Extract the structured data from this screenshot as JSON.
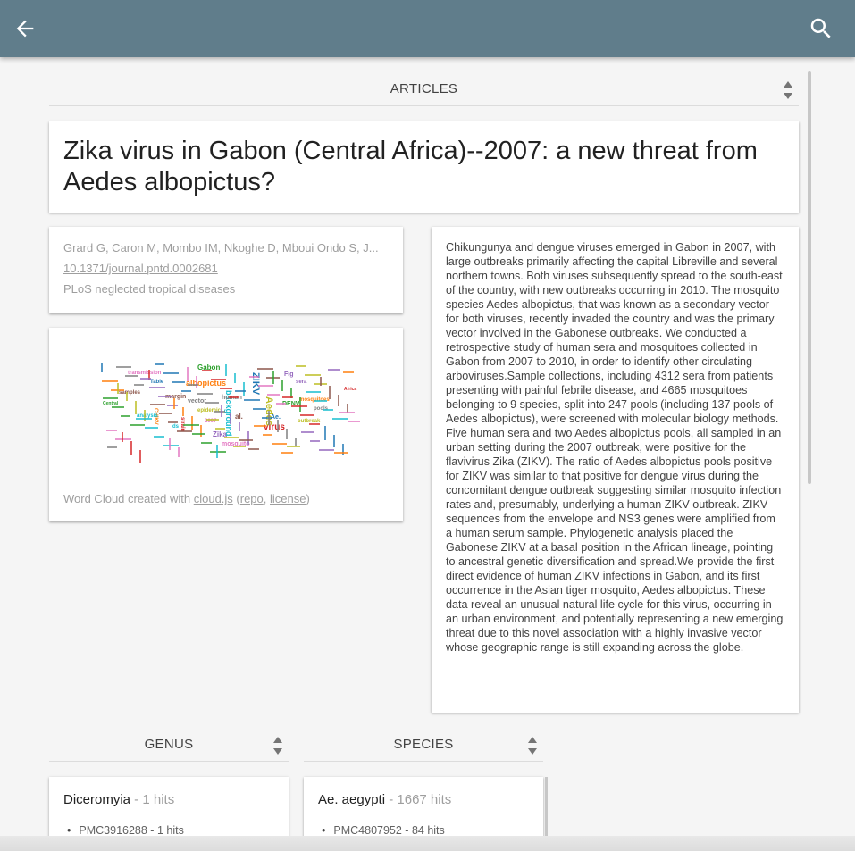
{
  "toolbar": {
    "back_icon": "arrow-back-icon",
    "search_icon": "search-icon",
    "color": "#607d8b"
  },
  "articles_header": {
    "label": "ARTICLES"
  },
  "article": {
    "title": "Zika virus in Gabon (Central Africa)--2007: a new threat from Aedes albopictus?",
    "authors": "Grard G, Caron M, Mombo IM, Nkoghe D, Mboui Ondo S, J...",
    "doi": "10.1371/journal.pntd.0002681",
    "journal": "PLoS neglected tropical diseases",
    "abstract": "Chikungunya and dengue viruses emerged in Gabon in 2007, with large outbreaks primarily affecting the capital Libreville and several northern towns. Both viruses subsequently spread to the south-east of the country, with new outbreaks occurring in 2010. The mosquito species Aedes albopictus, that was known as a secondary vector for both viruses, recently invaded the country and was the primary vector involved in the Gabonese outbreaks. We conducted a retrospective study of human sera and mosquitoes collected in Gabon from 2007 to 2010, in order to identify other circulating arboviruses.Sample collections, including 4312 sera from patients presenting with painful febrile disease, and 4665 mosquitoes belonging to 9 species, split into 247 pools (including 137 pools of Aedes albopictus), were screened with molecular biology methods. Five human sera and two Aedes albopictus pools, all sampled in an urban setting during the 2007 outbreak, were positive for the flavivirus Zika (ZIKV). The ratio of Aedes albopictus pools positive for ZIKV was similar to that positive for dengue virus during the concomitant dengue outbreak suggesting similar mosquito infection rates and, presumably, underlying a human ZIKV outbreak. ZIKV sequences from the envelope and NS3 genes were amplified from a human serum sample. Phylogenetic analysis placed the Gabonese ZIKV at a basal position in the African lineage, pointing to ancestral genetic diversification and spread.We provide the first direct evidence of human ZIKV infections in Gabon, and its first occurrence in the Asian tiger mosquito, Aedes albopictus. These data reveal an unusual natural life cycle for this virus, occurring in an urban environment, and potentially representing a new emerging threat due to this novel association with a highly invasive vector whose geographic range is still expanding across the globe."
  },
  "word_cloud": {
    "credit_prefix": "Word Cloud created with ",
    "lib_link": "cloud.js",
    "open_paren": " (",
    "repo_link": "repo",
    "comma": ", ",
    "license_link": "license",
    "close_paren": ")",
    "words": [
      "ZIKV",
      "albopictus",
      "Gabon",
      "virus",
      "Zika",
      "margin",
      "mosquito",
      "vector",
      "Aedes",
      "background",
      "Table",
      "CHIKV",
      "DENV",
      "strain",
      "sera",
      "samples",
      "transmission",
      "pools",
      "outbreak",
      "analysis",
      "Ae.",
      "mosquitoes",
      "Central",
      "Africa",
      "Fig",
      "al.",
      "2007",
      "human",
      "epidemic",
      "ds"
    ]
  },
  "genus_header": {
    "label": "GENUS"
  },
  "species_header": {
    "label": "SPECIES"
  },
  "genus_result": {
    "name": "Diceromyia",
    "hits": " - 1 hits",
    "items": [
      "PMC3916288 - 1 hits"
    ]
  },
  "species_result": {
    "name": "Ae. aegypti",
    "hits": " - 1667 hits",
    "items": [
      "PMC4807952 - 84 hits"
    ]
  }
}
